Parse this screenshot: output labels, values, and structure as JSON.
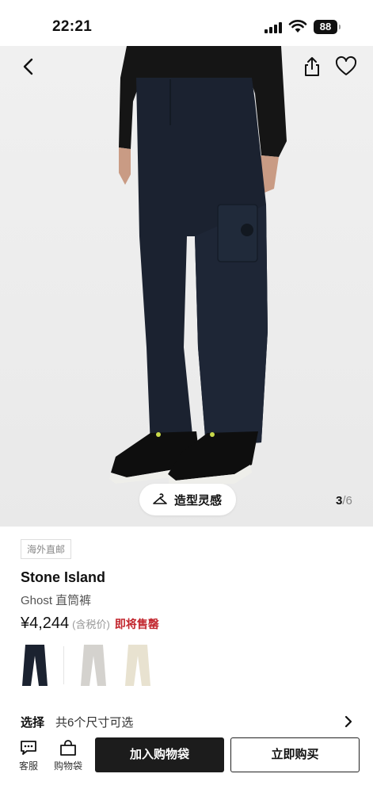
{
  "status_bar": {
    "time": "22:21",
    "battery": "88"
  },
  "gallery": {
    "inspo_label": "造型灵感",
    "current_page": "3",
    "separator": "/",
    "total_pages": "6"
  },
  "product": {
    "tag": "海外直邮",
    "brand": "Stone Island",
    "name": "Ghost 直筒裤",
    "price": "¥4,244",
    "tax_note": "(含税价)",
    "stock_status": "即将售罄",
    "swatches": [
      {
        "color": "#1b2230",
        "label": "navy"
      },
      {
        "color": "#d4d2ce",
        "label": "grey"
      },
      {
        "color": "#e8e2d0",
        "label": "ecru"
      }
    ]
  },
  "size_selector": {
    "title": "选择",
    "description": "共6个尺寸可选"
  },
  "bottom_bar": {
    "service_label": "客服",
    "bag_label": "购物袋",
    "add_to_bag": "加入购物袋",
    "buy_now": "立即购买"
  },
  "colors": {
    "sellout_red": "#c2262e",
    "primary_button": "#1c1c1c"
  }
}
